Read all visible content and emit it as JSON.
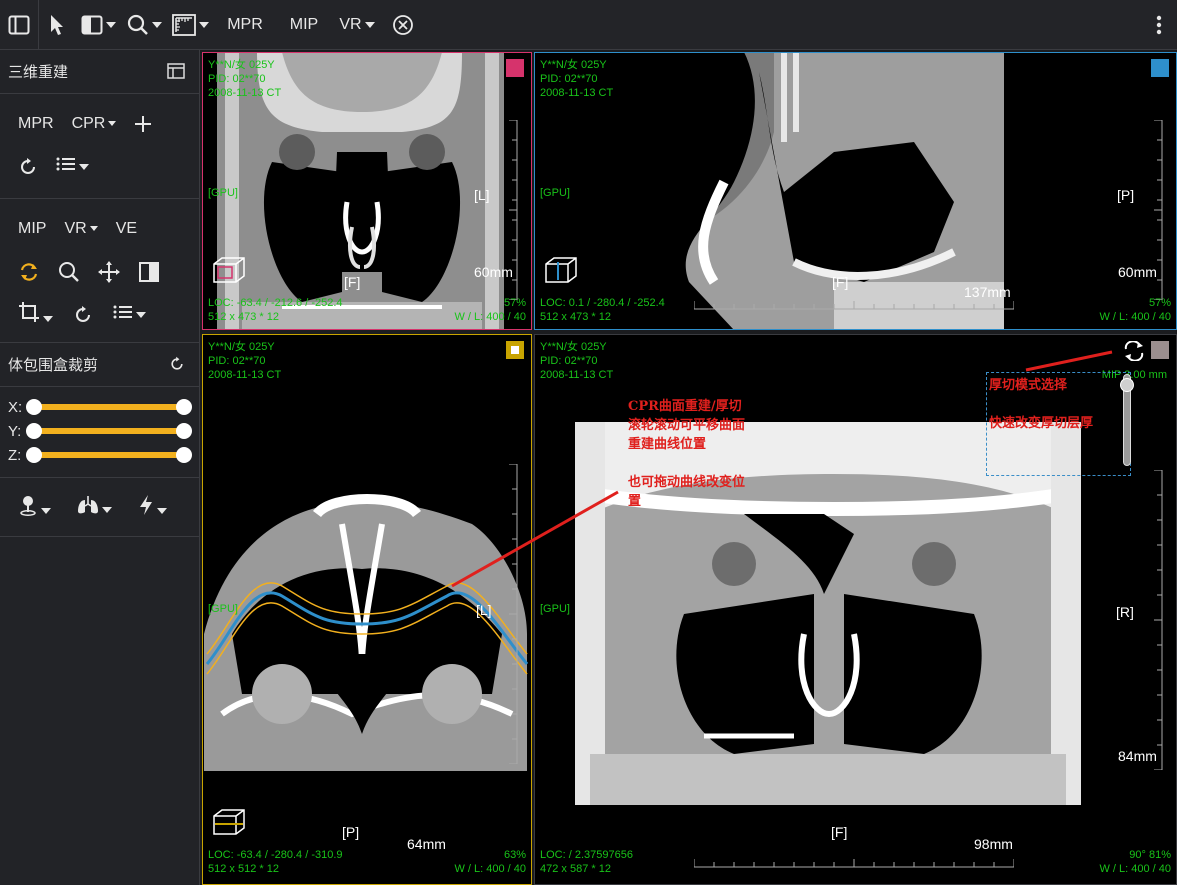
{
  "toolbar": {
    "items": [
      {
        "label": "MPR"
      },
      {
        "label": "MIP"
      },
      {
        "label": "VR"
      }
    ]
  },
  "sidebar": {
    "title": "三维重建",
    "row1": {
      "mpr": "MPR",
      "cpr": "CPR"
    },
    "row3": {
      "mip": "MIP",
      "vr": "VR",
      "ve": "VE"
    },
    "crop_title": "体包围盒裁剪",
    "sliders": [
      {
        "axis": "X:",
        "min": 0,
        "max": 1
      },
      {
        "axis": "Y:",
        "min": 0,
        "max": 1
      },
      {
        "axis": "Z:",
        "min": 0,
        "max": 1
      }
    ]
  },
  "colors": {
    "accent": "#f2b01e",
    "overlay_text": "#19c319",
    "annotation": "#e0201d",
    "vp1": "#d6336c",
    "vp2": "#2e8fcb",
    "vp3": "#c8a400",
    "vp4": "#9b8e8e"
  },
  "viewports": [
    {
      "name": "Y**N/女 025Y",
      "pid": "PID: 02**70",
      "date": "2008-11-13 CT",
      "gpu": "[GPU]",
      "orient_right": "[L]",
      "orient_bottom": "[F]",
      "scale": "60mm",
      "loc": "LOC: -63.4 / -212.6 / -252.4",
      "dims": "512 x 473 * 12",
      "zoom": "57%",
      "wl": "W / L:  400 / 40"
    },
    {
      "name": "Y**N/女 025Y",
      "pid": "PID: 02**70",
      "date": "2008-11-13 CT",
      "gpu": "[GPU]",
      "orient_right": "[P]",
      "orient_bottom": "[F]",
      "scale": "60mm",
      "scale2": "137mm",
      "loc": "LOC: 0.1 / -280.4 / -252.4",
      "dims": "512 x 473 * 12",
      "zoom": "57%",
      "wl": "W / L:  400 / 40"
    },
    {
      "name": "Y**N/女 025Y",
      "pid": "PID: 02**70",
      "date": "2008-11-13 CT",
      "gpu": "[GPU]",
      "orient_right": "[L]",
      "orient_bottom": "[P]",
      "scale": "64mm",
      "loc": "LOC: -63.4 / -280.4 / -310.9",
      "dims": "512 x 512 * 12",
      "zoom": "63%",
      "wl": "W / L:  400 / 40"
    },
    {
      "name": "Y**N/女 025Y",
      "pid": "PID: 02**70",
      "date": "2008-11-13 CT",
      "gpu": "[GPU]",
      "orient_right": "[R]",
      "orient_bottom": "[F]",
      "scale": "84mm",
      "scale2": "98mm",
      "mip": "MIP 3.00 mm",
      "loc": "LOC:  / 2.37597656",
      "dims": "472 x 587 * 12",
      "zoom": "90° 81%",
      "wl": "W / L:  400 / 40"
    }
  ],
  "annotations": {
    "cpr_line1": "CPR曲面重建/厚切",
    "cpr_line2": "滚轮滚动可平移曲面",
    "cpr_line3": "重建曲线位置",
    "drag_line1": "也可拖动曲线改变位",
    "drag_line2": "置",
    "thick_mode": "厚切模式选择",
    "thick_fast": "快速改变厚切层厚"
  }
}
